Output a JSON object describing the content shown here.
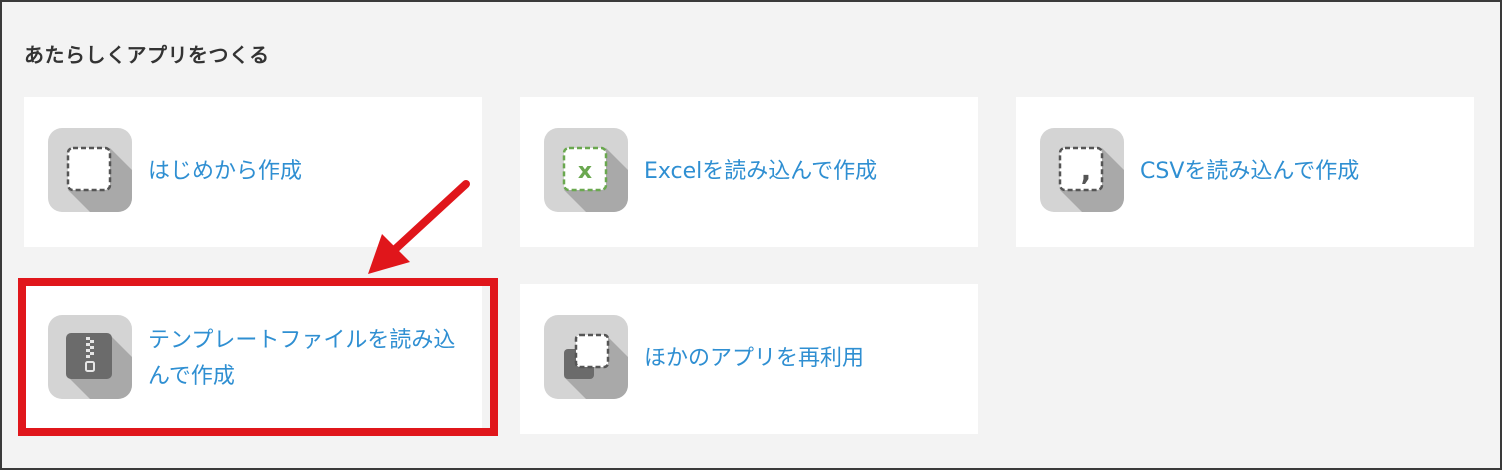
{
  "section": {
    "title": "あたらしくアプリをつくる"
  },
  "cards": [
    {
      "label": "はじめから作成",
      "icon": "blank-app-icon"
    },
    {
      "label": "Excelを読み込んで作成",
      "icon": "excel-import-icon",
      "icon_glyph": "x"
    },
    {
      "label": "CSVを読み込んで作成",
      "icon": "csv-import-icon",
      "icon_glyph": ","
    },
    {
      "label": "テンプレートファイルを読み込んで作成",
      "icon": "zip-template-icon"
    },
    {
      "label": "ほかのアプリを再利用",
      "icon": "reuse-app-icon"
    }
  ],
  "colors": {
    "link": "#2f8fd2",
    "highlight": "#e0161b",
    "excel_green": "#6aa84f",
    "background": "#f3f3f3"
  }
}
